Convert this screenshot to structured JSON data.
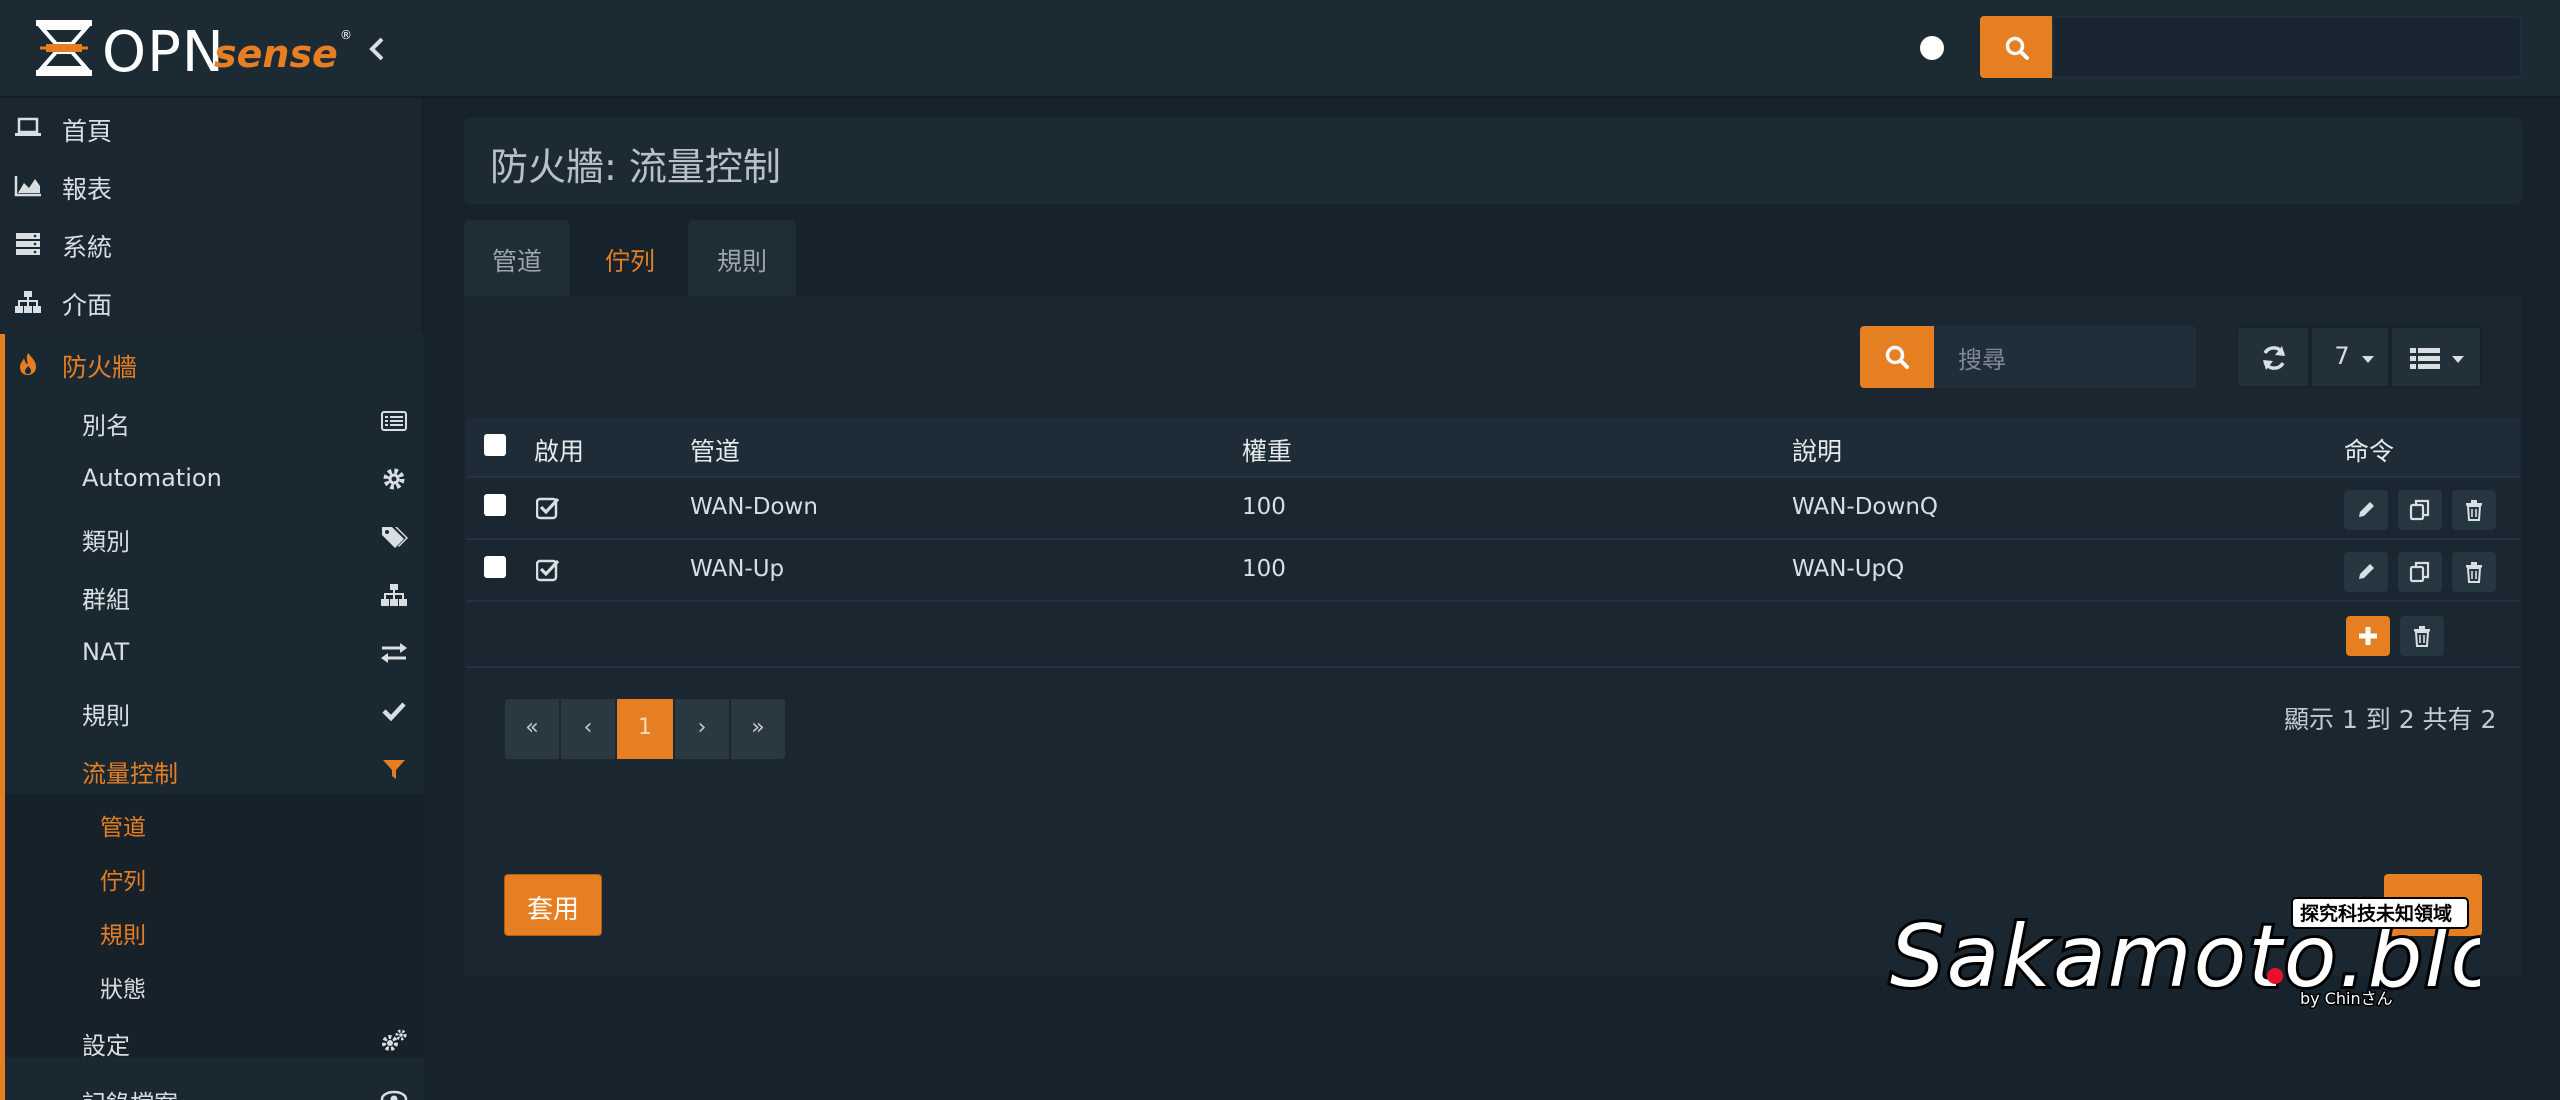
{
  "app": {
    "logo_opn": "OPN",
    "logo_sense": "sense",
    "logo_reg": "®"
  },
  "sidebar": {
    "top_items": [
      {
        "label": "首頁",
        "icon": "laptop-icon"
      },
      {
        "label": "報表",
        "icon": "area-chart-icon"
      },
      {
        "label": "系統",
        "icon": "server-icon"
      },
      {
        "label": "介面",
        "icon": "sitemap-icon"
      },
      {
        "label": "防火牆",
        "icon": "fire-icon"
      }
    ],
    "firewall_items": [
      {
        "label": "別名",
        "icon": "list-alt-icon"
      },
      {
        "label": "Automation",
        "icon": "gear-icon"
      },
      {
        "label": "類別",
        "icon": "tags-icon"
      },
      {
        "label": "群組",
        "icon": "sitemap-icon"
      },
      {
        "label": "NAT",
        "icon": "exchange-icon"
      },
      {
        "label": "規則",
        "icon": "check-icon"
      },
      {
        "label": "流量控制",
        "icon": "filter-icon"
      }
    ],
    "traffic_items": [
      "管道",
      "佇列",
      "規則",
      "狀態"
    ],
    "bottom_items": [
      {
        "label": "設定",
        "icon": "gears-icon"
      },
      {
        "label": "記錄檔案",
        "icon": "eye-icon"
      }
    ]
  },
  "page": {
    "title": "防火牆: 流量控制"
  },
  "tabs": [
    "管道",
    "佇列",
    "規則"
  ],
  "grid": {
    "search_placeholder": "搜尋",
    "page_size": "7",
    "columns": [
      "啟用",
      "管道",
      "權重",
      "說明",
      "命令"
    ],
    "rows": [
      {
        "enabled": true,
        "pipe": "WAN-Down",
        "weight": "100",
        "description": "WAN-DownQ"
      },
      {
        "enabled": true,
        "pipe": "WAN-Up",
        "weight": "100",
        "description": "WAN-UpQ"
      }
    ],
    "pager": [
      "«",
      "‹",
      "1",
      "›",
      "»"
    ],
    "info": "顯示 1 到 2 共有 2"
  },
  "actions": {
    "apply_label": "套用"
  },
  "watermark": {
    "text": "Sakamoto.blog",
    "tagline": "探究科技未知領域",
    "by": "by Chinさん"
  },
  "colors": {
    "accent": "#e67e22",
    "background": "#17232c",
    "panel": "#1a2730"
  }
}
